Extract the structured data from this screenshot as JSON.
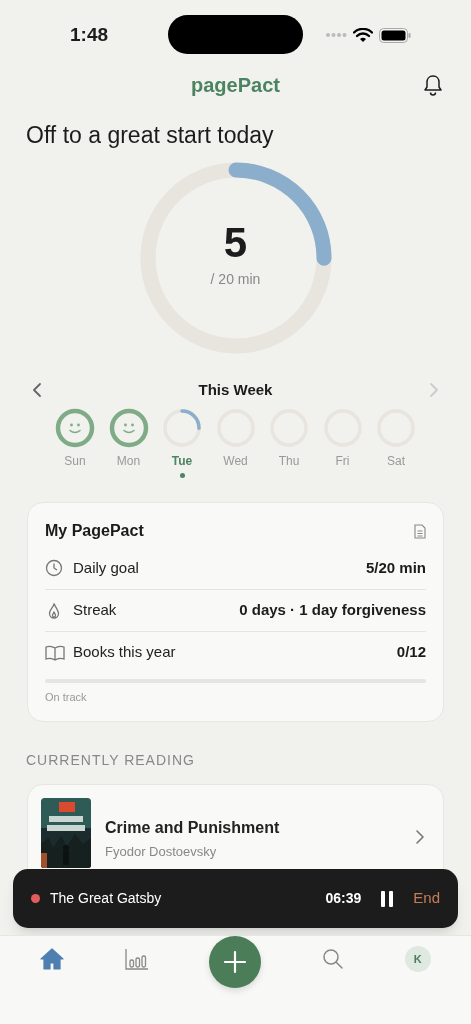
{
  "status_bar": {
    "time": "1:48"
  },
  "header": {
    "title": "pagePact"
  },
  "heading": "Off to a great start today",
  "progress": {
    "value": "5",
    "unit": "/ 20 min",
    "level": 0.25
  },
  "week": {
    "title": "This Week",
    "prev_enabled": true,
    "next_enabled": false,
    "days": [
      {
        "label": "Sun",
        "kind": "done",
        "selected": false
      },
      {
        "label": "Mon",
        "kind": "done",
        "selected": false
      },
      {
        "label": "Tue",
        "kind": "progress",
        "selected": true
      },
      {
        "label": "Wed",
        "kind": "empty",
        "selected": false
      },
      {
        "label": "Thu",
        "kind": "empty",
        "selected": false
      },
      {
        "label": "Fri",
        "kind": "empty",
        "selected": false
      },
      {
        "label": "Sat",
        "kind": "empty",
        "selected": false
      }
    ]
  },
  "pact_card": {
    "title": "My PagePact",
    "rows": [
      {
        "kind": "clock",
        "label": "Daily goal",
        "value": "5/20 min"
      },
      {
        "kind": "flame",
        "label": "Streak",
        "value": "0 days · 1 day forgiveness"
      },
      {
        "kind": "book",
        "label": "Books this year",
        "value": "0/12"
      }
    ],
    "status": "On track"
  },
  "currently_reading": {
    "title": "CURRENTLY READING",
    "books": [
      {
        "title": "Crime and Punishment",
        "author": "Fyodor Dostoevsky"
      }
    ]
  },
  "now_playing": {
    "title": "The Great Gatsby",
    "time": "06:39",
    "end": "End"
  },
  "tab_bar": {
    "items": [
      {
        "kind": "home",
        "selected": true
      },
      {
        "kind": "stats",
        "selected": false
      },
      {
        "kind": "add",
        "selected": false
      },
      {
        "kind": "search",
        "selected": false
      },
      {
        "kind": "profile",
        "label": "K",
        "selected": false
      }
    ]
  }
}
